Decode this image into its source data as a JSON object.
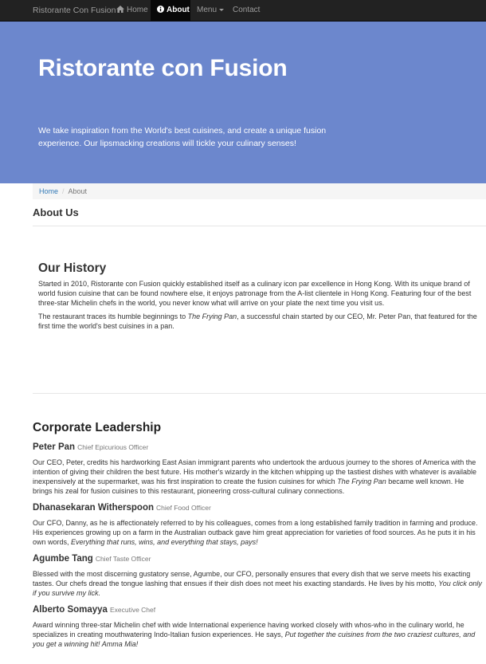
{
  "navbar": {
    "brand": "Ristorante Con Fusion",
    "items": [
      {
        "label": "Home",
        "icon": "home-icon"
      },
      {
        "label": "About",
        "icon": "info-circle-icon",
        "active": true
      },
      {
        "label": "Menu",
        "icon": "caret-down-icon"
      },
      {
        "label": "Contact"
      }
    ]
  },
  "jumbotron": {
    "title": "Ristorante con Fusion",
    "text": "We take inspiration from the World's best cuisines, and create a unique fusion experience. Our lipsmacking creations will tickle your culinary senses!"
  },
  "breadcrumb": {
    "home": "Home",
    "separator": "/",
    "current": "About"
  },
  "page": {
    "heading": "About Us"
  },
  "history": {
    "title": "Our History",
    "p1": "Started in 2010, Ristorante con Fusion quickly established itself as a culinary icon par excellence in Hong Kong. With its unique brand of world fusion cuisine that can be found nowhere else, it enjoys patronage from the A-list clientele in Hong Kong. Featuring four of the best three-star Michelin chefs in the world, you never know what will arrive on your plate the next time you visit us.",
    "p2_before": "The restaurant traces its humble beginnings to ",
    "p2_em": "The Frying Pan",
    "p2_after": ", a successful chain started by our CEO, Mr. Peter Pan, that featured for the first time the world's best cuisines in a pan."
  },
  "leadership": {
    "title": "Corporate Leadership",
    "leaders": [
      {
        "name": "Peter Pan",
        "designation": "Chief Epicurious Officer",
        "desc_before": "Our CEO, Peter, credits his hardworking East Asian immigrant parents who undertook the arduous journey to the shores of America with the intention of giving their children the best future. His mother's wizardy in the kitchen whipping up the tastiest dishes with whatever is available inexpensively at the supermarket, was his first inspiration to create the fusion cuisines for which ",
        "desc_em": "The Frying Pan",
        "desc_after": " became well known. He brings his zeal for fusion cuisines to this restaurant, pioneering cross-cultural culinary connections."
      },
      {
        "name": "Dhanasekaran Witherspoon",
        "designation": "Chief Food Officer",
        "desc_before": "Our CFO, Danny, as he is affectionately referred to by his colleagues, comes from a long established family tradition in farming and produce. His experiences growing up on a farm in the Australian outback gave him great appreciation for varieties of food sources. As he puts it in his own words, ",
        "desc_em": "Everything that runs, wins, and everything that stays, pays!",
        "desc_after": ""
      },
      {
        "name": "Agumbe Tang",
        "designation": "Chief Taste Officer",
        "desc_before": "Blessed with the most discerning gustatory sense, Agumbe, our CFO, personally ensures that every dish that we serve meets his exacting tastes. Our chefs dread the tongue lashing that ensues if their dish does not meet his exacting standards. He lives by his motto, ",
        "desc_em": "You click only if you survive my lick.",
        "desc_after": ""
      },
      {
        "name": "Alberto Somayya",
        "designation": "Executive Chef",
        "desc_before": "Award winning three-star Michelin chef with wide International experience having worked closely with whos-who in the culinary world, he specializes in creating mouthwatering Indo-Italian fusion experiences. He says, ",
        "desc_em": "Put together the cuisines from the two craziest cultures, and you get a winning hit! Amma Mia!",
        "desc_after": ""
      }
    ]
  },
  "colors": {
    "navbar": "#222222",
    "jumbotron": "#6c87cd",
    "link": "#337ab7"
  }
}
